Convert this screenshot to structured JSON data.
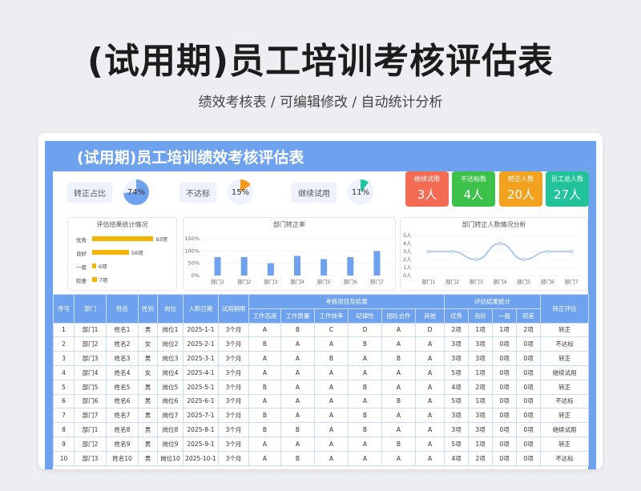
{
  "page": {
    "title": "(试用期)员工培训考核评估表",
    "subtitle": "绩效考核表 /  可编辑修改  / 自动统计分析"
  },
  "sheet": {
    "title": "(试用期)员工培训绩效考核评估表",
    "kpis": [
      {
        "label": "转正占比",
        "value": "74%",
        "fraction": 0.74,
        "color": "#6ea1ee"
      },
      {
        "label": "不达标",
        "value": "15%",
        "fraction": 0.15,
        "color": "#f39a1e"
      },
      {
        "label": "继续试用",
        "value": "11%",
        "fraction": 0.11,
        "color": "#1fc7a0"
      }
    ],
    "stat_cards": [
      {
        "label": "继续试用",
        "value": "3人",
        "color": "#f26b52"
      },
      {
        "label": "不达标数",
        "value": "4人",
        "color": "#3cc24a"
      },
      {
        "label": "转正人数",
        "value": "20人",
        "color": "#f3a21f"
      },
      {
        "label": "员工总人数",
        "value": "27人",
        "color": "#22c29a"
      }
    ]
  },
  "charts": {
    "eval": {
      "title": "评估结果统计情况",
      "color": "#f4b400",
      "chart_data": {
        "type": "bar",
        "orientation": "horizontal",
        "categories": [
          "优秀",
          "良好",
          "一般",
          "较差"
        ],
        "values": [
          93,
          56,
          6,
          7
        ],
        "labels": [
          "93项",
          "56项",
          "6项",
          "7项"
        ]
      }
    },
    "rate": {
      "title": "部门转正率",
      "color": "#6ea1ee",
      "chart_data": {
        "type": "bar",
        "categories": [
          "部门1",
          "部门2",
          "部门3",
          "部门4",
          "部门5",
          "部门6",
          "部门7"
        ],
        "values": [
          75,
          75,
          50,
          80,
          67,
          75,
          100
        ],
        "yticks": [
          "150%",
          "100%",
          "50%",
          "0%"
        ],
        "ylim": [
          0,
          150
        ]
      }
    },
    "count": {
      "title": "部门转正人数情况分析",
      "color": "#9cc0ee",
      "chart_data": {
        "type": "line",
        "categories": [
          "部门1",
          "部门2",
          "部门3",
          "部门4",
          "部门5",
          "部门6",
          "部门7"
        ],
        "values": [
          3,
          3,
          2,
          4,
          2,
          3,
          3
        ],
        "yticks": [
          "5人",
          "4人",
          "3人",
          "2人",
          "1人",
          "0人"
        ],
        "ylim": [
          0,
          5
        ]
      }
    }
  },
  "table": {
    "headers": {
      "idx": "序号",
      "dept": "部门",
      "name": "姓名",
      "gender": "性别",
      "post": "岗位",
      "date": "入职日期",
      "period": "试用期限",
      "group1": "考核项目及结果",
      "group2": "评估结果统计",
      "result": "转正评估",
      "items": [
        "工作态度",
        "工作质量",
        "工作效率",
        "纪律性",
        "团队合作",
        "其他"
      ],
      "stats": [
        "优秀",
        "良好",
        "一般",
        "较差"
      ]
    },
    "rows": [
      [
        "1",
        "部门1",
        "姓名1",
        "男",
        "岗位1",
        "2025-1-1",
        "3个月",
        "A",
        "B",
        "C",
        "D",
        "A",
        "D",
        "2项",
        "1项",
        "1项",
        "2项",
        "转正"
      ],
      [
        "2",
        "部门2",
        "姓名2",
        "女",
        "岗位2",
        "2025-2-1",
        "3个月",
        "B",
        "A",
        "A",
        "B",
        "A",
        "A",
        "3项",
        "3项",
        "0项",
        "0项",
        "不达标"
      ],
      [
        "3",
        "部门3",
        "姓名3",
        "男",
        "岗位3",
        "2025-3-1",
        "3个月",
        "A",
        "A",
        "B",
        "A",
        "B",
        "A",
        "3项",
        "3项",
        "0项",
        "0项",
        "转正"
      ],
      [
        "4",
        "部门4",
        "姓名4",
        "女",
        "岗位4",
        "2025-4-1",
        "3个月",
        "A",
        "A",
        "A",
        "A",
        "A",
        "A",
        "5项",
        "1项",
        "0项",
        "0项",
        "继续试用"
      ],
      [
        "5",
        "部门5",
        "姓名5",
        "男",
        "岗位5",
        "2025-5-1",
        "3个月",
        "B",
        "A",
        "A",
        "B",
        "A",
        "A",
        "4项",
        "2项",
        "0项",
        "0项",
        "转正"
      ],
      [
        "6",
        "部门6",
        "姓名6",
        "男",
        "岗位6",
        "2025-6-1",
        "3个月",
        "A",
        "A",
        "A",
        "A",
        "B",
        "A",
        "5项",
        "1项",
        "0项",
        "0项",
        "不达标"
      ],
      [
        "7",
        "部门7",
        "姓名7",
        "男",
        "岗位7",
        "2025-7-1",
        "3个月",
        "B",
        "A",
        "A",
        "B",
        "A",
        "A",
        "3项",
        "3项",
        "0项",
        "0项",
        "转正"
      ],
      [
        "8",
        "部门1",
        "姓名8",
        "男",
        "岗位8",
        "2025-8-1",
        "3个月",
        "B",
        "B",
        "A",
        "B",
        "A",
        "A",
        "3项",
        "3项",
        "0项",
        "0项",
        "继续试用"
      ],
      [
        "9",
        "部门2",
        "姓名9",
        "男",
        "岗位9",
        "2025-9-1",
        "3个月",
        "A",
        "A",
        "A",
        "A",
        "B",
        "A",
        "5项",
        "1项",
        "0项",
        "0项",
        "转正"
      ],
      [
        "10",
        "部门3",
        "姓名10",
        "男",
        "岗位10",
        "2025-10-1",
        "3个月",
        "A",
        "B",
        "A",
        "A",
        "A",
        "A",
        "4项",
        "2项",
        "0项",
        "0项",
        "不达标"
      ]
    ]
  }
}
